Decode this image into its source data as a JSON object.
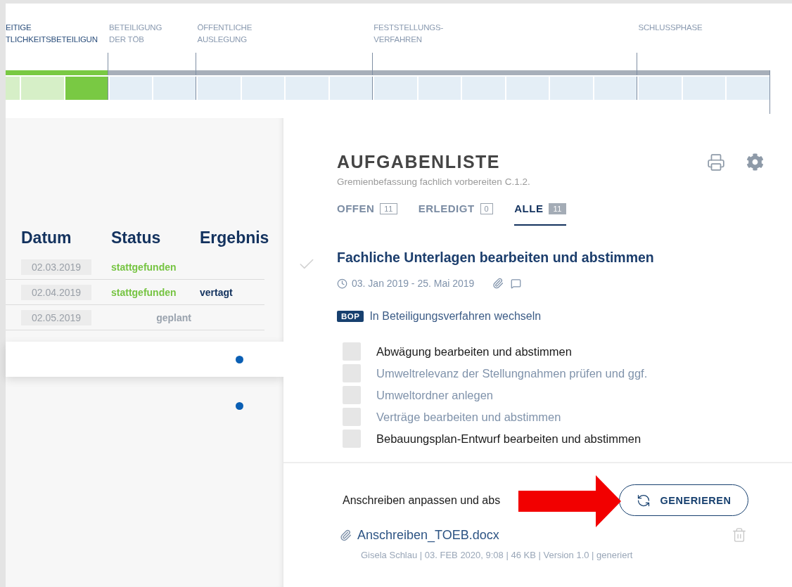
{
  "timeline": {
    "phases": [
      {
        "lines": [
          "EITIGE",
          "TLICHKEITSBETEILIGUN"
        ],
        "selected": true,
        "done": true,
        "cells": [
          {
            "kind": "done"
          },
          {
            "kind": "done"
          },
          {
            "kind": "current"
          }
        ]
      },
      {
        "lines": [
          "BETEILIGUNG",
          "DER TÖB"
        ],
        "selected": false,
        "done": false,
        "cells": [
          {
            "kind": "open"
          },
          {
            "kind": "open"
          }
        ]
      },
      {
        "lines": [
          "ÖFFENTLICHE",
          "AUSLEGUNG"
        ],
        "selected": false,
        "done": false,
        "cells": [
          {
            "kind": "open"
          },
          {
            "kind": "open"
          },
          {
            "kind": "open"
          },
          {
            "kind": "open"
          }
        ]
      },
      {
        "lines": [
          "FESTSTELLUNGS-",
          "VERFAHREN"
        ],
        "selected": false,
        "done": false,
        "cells": [
          {
            "kind": "open"
          },
          {
            "kind": "open"
          },
          {
            "kind": "open"
          },
          {
            "kind": "open"
          },
          {
            "kind": "open"
          },
          {
            "kind": "open"
          }
        ]
      },
      {
        "lines": [
          "SCHLUSSPHASE"
        ],
        "selected": false,
        "done": false,
        "cells": [
          {
            "kind": "open"
          },
          {
            "kind": "open"
          },
          {
            "kind": "open"
          }
        ]
      }
    ]
  },
  "meetings": {
    "columns": [
      "Datum",
      "Status",
      "Ergebnis"
    ],
    "rows": [
      {
        "date": "02.03.2019",
        "status": "stattgefunden",
        "kind": "done"
      },
      {
        "date": "02.04.2019",
        "status": "stattgefunden",
        "kind": "done",
        "result": "vertagt"
      },
      {
        "date": "02.05.2019",
        "status": "geplant",
        "kind": "planned"
      }
    ],
    "cards": [
      {
        "kind": "raised"
      },
      {
        "kind": "flat"
      }
    ]
  },
  "tasks": {
    "title": "AUFGABENLISTE",
    "subtitle": "Gremienbefassung fachlich vorbereiten C.1.2.",
    "tabs": [
      {
        "label": "OFFEN",
        "count": "11",
        "selected": false
      },
      {
        "label": "ERLEDIGT",
        "count": "0",
        "selected": false
      },
      {
        "label": "ALLE",
        "count": "11",
        "selected": true
      }
    ],
    "task": {
      "title": "Fachliche Unterlagen bearbeiten und abstimmen",
      "done": false,
      "dates": "03. Jan 2019 - 25. Mai 2019",
      "badge": "BOP",
      "action": "In Beteiligungsverfahren wechseln",
      "checklist": [
        {
          "label": "Abwägung bearbeiten und abstimmen",
          "checked": false,
          "disabled": false
        },
        {
          "label": "Umweltrelevanz der Stellungnahmen prüfen und ggf.",
          "checked": false,
          "disabled": true
        },
        {
          "label": "Umweltordner anlegen",
          "checked": false,
          "disabled": true
        },
        {
          "label": "Verträge bearbeiten und abstimmen",
          "checked": false,
          "disabled": true
        },
        {
          "label": "Bebauungsplan-Entwurf bearbeiten und abstimmen",
          "checked": false,
          "disabled": false
        }
      ]
    },
    "letter": {
      "label": "Anschreiben anpassen und abs",
      "button": "GENERIEREN",
      "file": "Anschreiben_TOEB.docx",
      "file_meta": "Gisela Schlau | 03. FEB 2020, 9:08 | 46 KB | Version 1.0 | generiert"
    }
  }
}
